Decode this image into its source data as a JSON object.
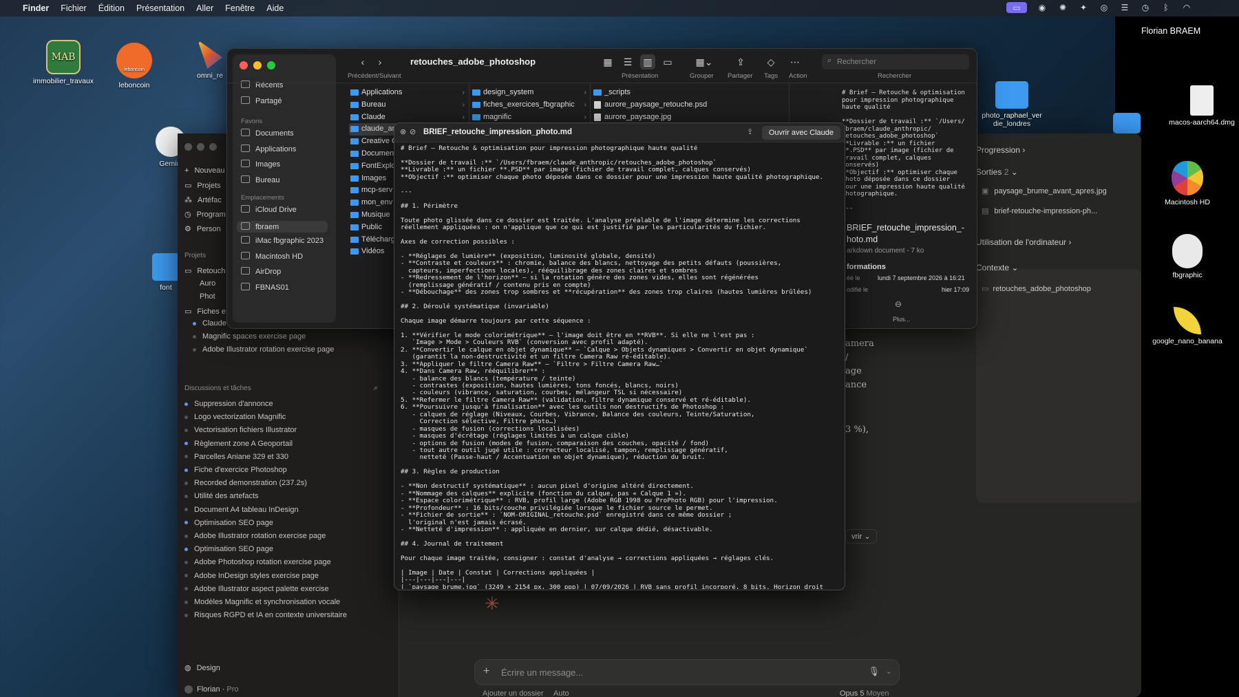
{
  "menubar": {
    "app": "Finder",
    "items": [
      "Fichier",
      "Édition",
      "Présentation",
      "Aller",
      "Fenêtre",
      "Aide"
    ],
    "user": "Florian BRAEM"
  },
  "desktop": {
    "icons": {
      "mab": "immobilier_travaux",
      "leboncoin": "leboncoin",
      "omni": "omni_re",
      "gemini": "Gemini",
      "photo": "photo_raphael_ver die_londres",
      "dmg": "macos-aarch64.dmg",
      "hd": "Macintosh HD",
      "fbgraphic": "fbgraphic",
      "banana": "google_nano_banana",
      "font": "font"
    },
    "logo_mab": "MAB",
    "logo_leboncoin": "leboncoin"
  },
  "claude_app": {
    "nav": [
      "Nouveau",
      "Projets",
      "Artéfac",
      "Program",
      "Person"
    ],
    "projects_header": "Projets",
    "project_items": [
      "Retouch",
      "Auro",
      "Phot",
      "Fiches e"
    ],
    "fiches": [
      "Claude Chrome exercise page creation",
      "Magnific spaces exercise page",
      "Adobe Illustrator rotation exercise page"
    ],
    "discussions_header": "Discussions et tâches",
    "discussions": [
      "Suppression d'annonce",
      "Logo vectorization Magnific",
      "Vectorisation fichiers Illustrator",
      "Règlement zone A Geoportail",
      "Parcelles Aniane 329 et 330",
      "Fiche d'exercice Photoshop",
      "Recorded demonstration (237.2s)",
      "Utilité des artefacts",
      "Document A4 tableau InDesign",
      "Optimisation SEO page",
      "Adobe Illustrator rotation exercise page",
      "Optimisation SEO page",
      "Adobe Photoshop rotation exercise page",
      "Adobe InDesign styles exercise page",
      "Adobe Illustrator aspect palette exercise",
      "Modèles Magnific et synchronisation vocale",
      "Risques RGPD et IA en contexte universitaire"
    ],
    "design": "Design",
    "user": "Florian",
    "plan": "Pro",
    "right": {
      "progression": "Progression",
      "sorties": "Sorties",
      "sorties_count": "2",
      "files": [
        "paysage_brume_avant_apres.jpg",
        "brief-retouche-impression-ph..."
      ],
      "usage": "Utilisation de l'ordinateur",
      "contexte": "Contexte",
      "folder": "retouches_adobe_photoshop"
    },
    "fragments": [
      "amera",
      "/",
      "age",
      "ance",
      "3 %),",
      "vrir"
    ],
    "compose_placeholder": "Écrire un message...",
    "bottom": [
      "Ajouter un dossier",
      "Auto",
      "Opus 5",
      "Moyen"
    ]
  },
  "finder": {
    "title": "retouches_adobe_photoshop",
    "toolbar_labels": {
      "nav": "Précédent/Suivant",
      "view": "Présentation",
      "group": "Grouper",
      "share": "Partager",
      "tags": "Tags",
      "action": "Action",
      "search": "Rechercher"
    },
    "search_placeholder": "Rechercher",
    "sidebar": {
      "items1": [
        "Récents",
        "Partagé"
      ],
      "fav": "Favoris",
      "items2": [
        "Documents",
        "Applications",
        "Images",
        "Bureau"
      ],
      "loc": "Emplacements",
      "items3": [
        "iCloud Drive",
        "fbraem",
        "iMac fbgraphic 2023",
        "Macintosh HD",
        "AirDrop",
        "FBNAS01"
      ]
    },
    "col1": [
      "Applications",
      "Bureau",
      "Claude",
      "claude_an",
      "Creative C",
      "Documen",
      "FontExplo",
      "Images",
      "mcp-serv",
      "mon_env",
      "Musique",
      "Public",
      "Télécharg",
      "Vidéos"
    ],
    "col2": [
      "design_system",
      "fiches_exercices_fbgraphic",
      "magnific"
    ],
    "col3": [
      "_scripts",
      "aurore_paysage_retouche.psd",
      "aurore_paysage.jpg"
    ],
    "preview_text": "# Brief — Retouche & optimisation\npour impression photographique\nhaute qualité\n\n**Dossier de travail :** `/Users/\nfbraem/claude_anthropic/\nretouches_adobe_photoshop`\n**Livrable :** un fichier\n**.PSD** par image (fichier de\ntravail complet, calques\nconservés)\n**Objectif :** optimiser chaque\nphoto déposée dans ce dossier\npour une impression haute qualité\nphotographique.\n\n---",
    "file_name": "BRIEF_retouche_impression_-\nhoto.md",
    "file_kind": "arkdown document - 7 ko",
    "info_header": "formations",
    "created_lbl": "éé le",
    "created": "lundi 7 septembre 2026 à 16:21",
    "modified_lbl": "odifié le",
    "modified": "hier 17:09",
    "more": "Plus..."
  },
  "preview": {
    "title": "BRIEF_retouche_impression_photo.md",
    "open_button": "Ouvrir avec Claude",
    "text": "# Brief — Retouche & optimisation pour impression photographique haute qualité\n\n**Dossier de travail :** `/Users/fbraem/claude_anthropic/retouches_adobe_photoshop`\n**Livrable :** un fichier **.PSD** par image (fichier de travail complet, calques conservés)\n**Objectif :** optimiser chaque photo déposée dans ce dossier pour une impression haute qualité photographique.\n\n---\n\n## 1. Périmètre\n\nToute photo glissée dans ce dossier est traitée. L'analyse préalable de l'image détermine les corrections\nréellement appliquées : on n'applique que ce qui est justifié par les particularités du fichier.\n\nAxes de correction possibles :\n\n- **Réglages de lumière** (exposition, luminosité globale, densité)\n- **Contraste et couleurs** : chromie, balance des blancs, nettoyage des petits défauts (poussières,\n  capteurs, imperfections locales), rééquilibrage des zones claires et sombres\n- **Redressement de l'horizon** — si la rotation génère des zones vides, elles sont régénérées\n  (remplissage génératif / contenu pris en compte)\n- **Débouchage** des zones trop sombres et **récupération** des zones trop claires (hautes lumières brûlées)\n\n## 2. Déroulé systématique (invariable)\n\nChaque image démarre toujours par cette séquence :\n\n1. **Vérifier le mode colorimétrique** — l'image doit être en **RVB**. Si elle ne l'est pas :\n   `Image > Mode > Couleurs RVB` (conversion avec profil adapté).\n2. **Convertir le calque en objet dynamique** — `Calque > Objets dynamiques > Convertir en objet dynamique`\n   (garantit la non-destructivité et un filtre Camera Raw ré-éditable).\n3. **Appliquer le filtre Camera Raw** — `Filtre > Filtre Camera Raw…`\n4. **Dans Camera Raw, rééquilibrer** :\n   - balance des blancs (température / teinte)\n   - contrastes (exposition, hautes lumières, tons foncés, blancs, noirs)\n   - couleurs (vibrance, saturation, courbes, mélangeur TSL si nécessaire)\n5. **Refermer le filtre Camera Raw** (validation, filtre dynamique conservé et ré-éditable).\n6. **Poursuivre jusqu'à finalisation** avec les outils non destructifs de Photoshop :\n   - calques de réglage (Niveaux, Courbes, Vibrance, Balance des couleurs, Teinte/Saturation,\n     Correction sélective, Filtre photo…)\n   - masques de fusion (corrections localisées)\n   - masques d'écrêtage (réglages limités à un calque cible)\n   - options de fusion (modes de fusion, comparaison des couches, opacité / fond)\n   - tout autre outil jugé utile : correcteur localisé, tampon, remplissage génératif,\n     netteté (Passe-haut / Accentuation en objet dynamique), réduction du bruit.\n\n## 3. Règles de production\n\n- **Non destructif systématique** : aucun pixel d'origine altéré directement.\n- **Nommage des calques** explicite (fonction du calque, pas « Calque 1 »).\n- **Espace colorimétrique** : RVB, profil large (Adobe RGB 1998 ou ProPhoto RGB) pour l'impression.\n- **Profondeur** : 16 bits/couche privilégiée lorsque le fichier source le permet.\n- **Fichier de sortie** : `NOM-ORIGINAL_retouche.psd` enregistré dans ce même dossier ;\n  l'original n'est jamais écrasé.\n- **Netteté d'impression** : appliquée en dernier, sur calque dédié, désactivable.\n\n## 4. Journal de traitement\n\nPour chaque image traitée, consigner : constat d'analyse → corrections appliquées → réglages clés.\n\n| Image | Date | Constat | Corrections appliquées |\n|---|---|---|---|\n| `paysage_brume.jpg` (3249 × 2154 px, 300 ppp) | 07/09/2026 | RVB sans profil incorporé, 8 bits. Horizon droit"
  },
  "colors": {
    "accent": "#d97757",
    "folder": "#3d9af0",
    "close": "#ff5f57",
    "min": "#febc2e",
    "max": "#28c840"
  }
}
